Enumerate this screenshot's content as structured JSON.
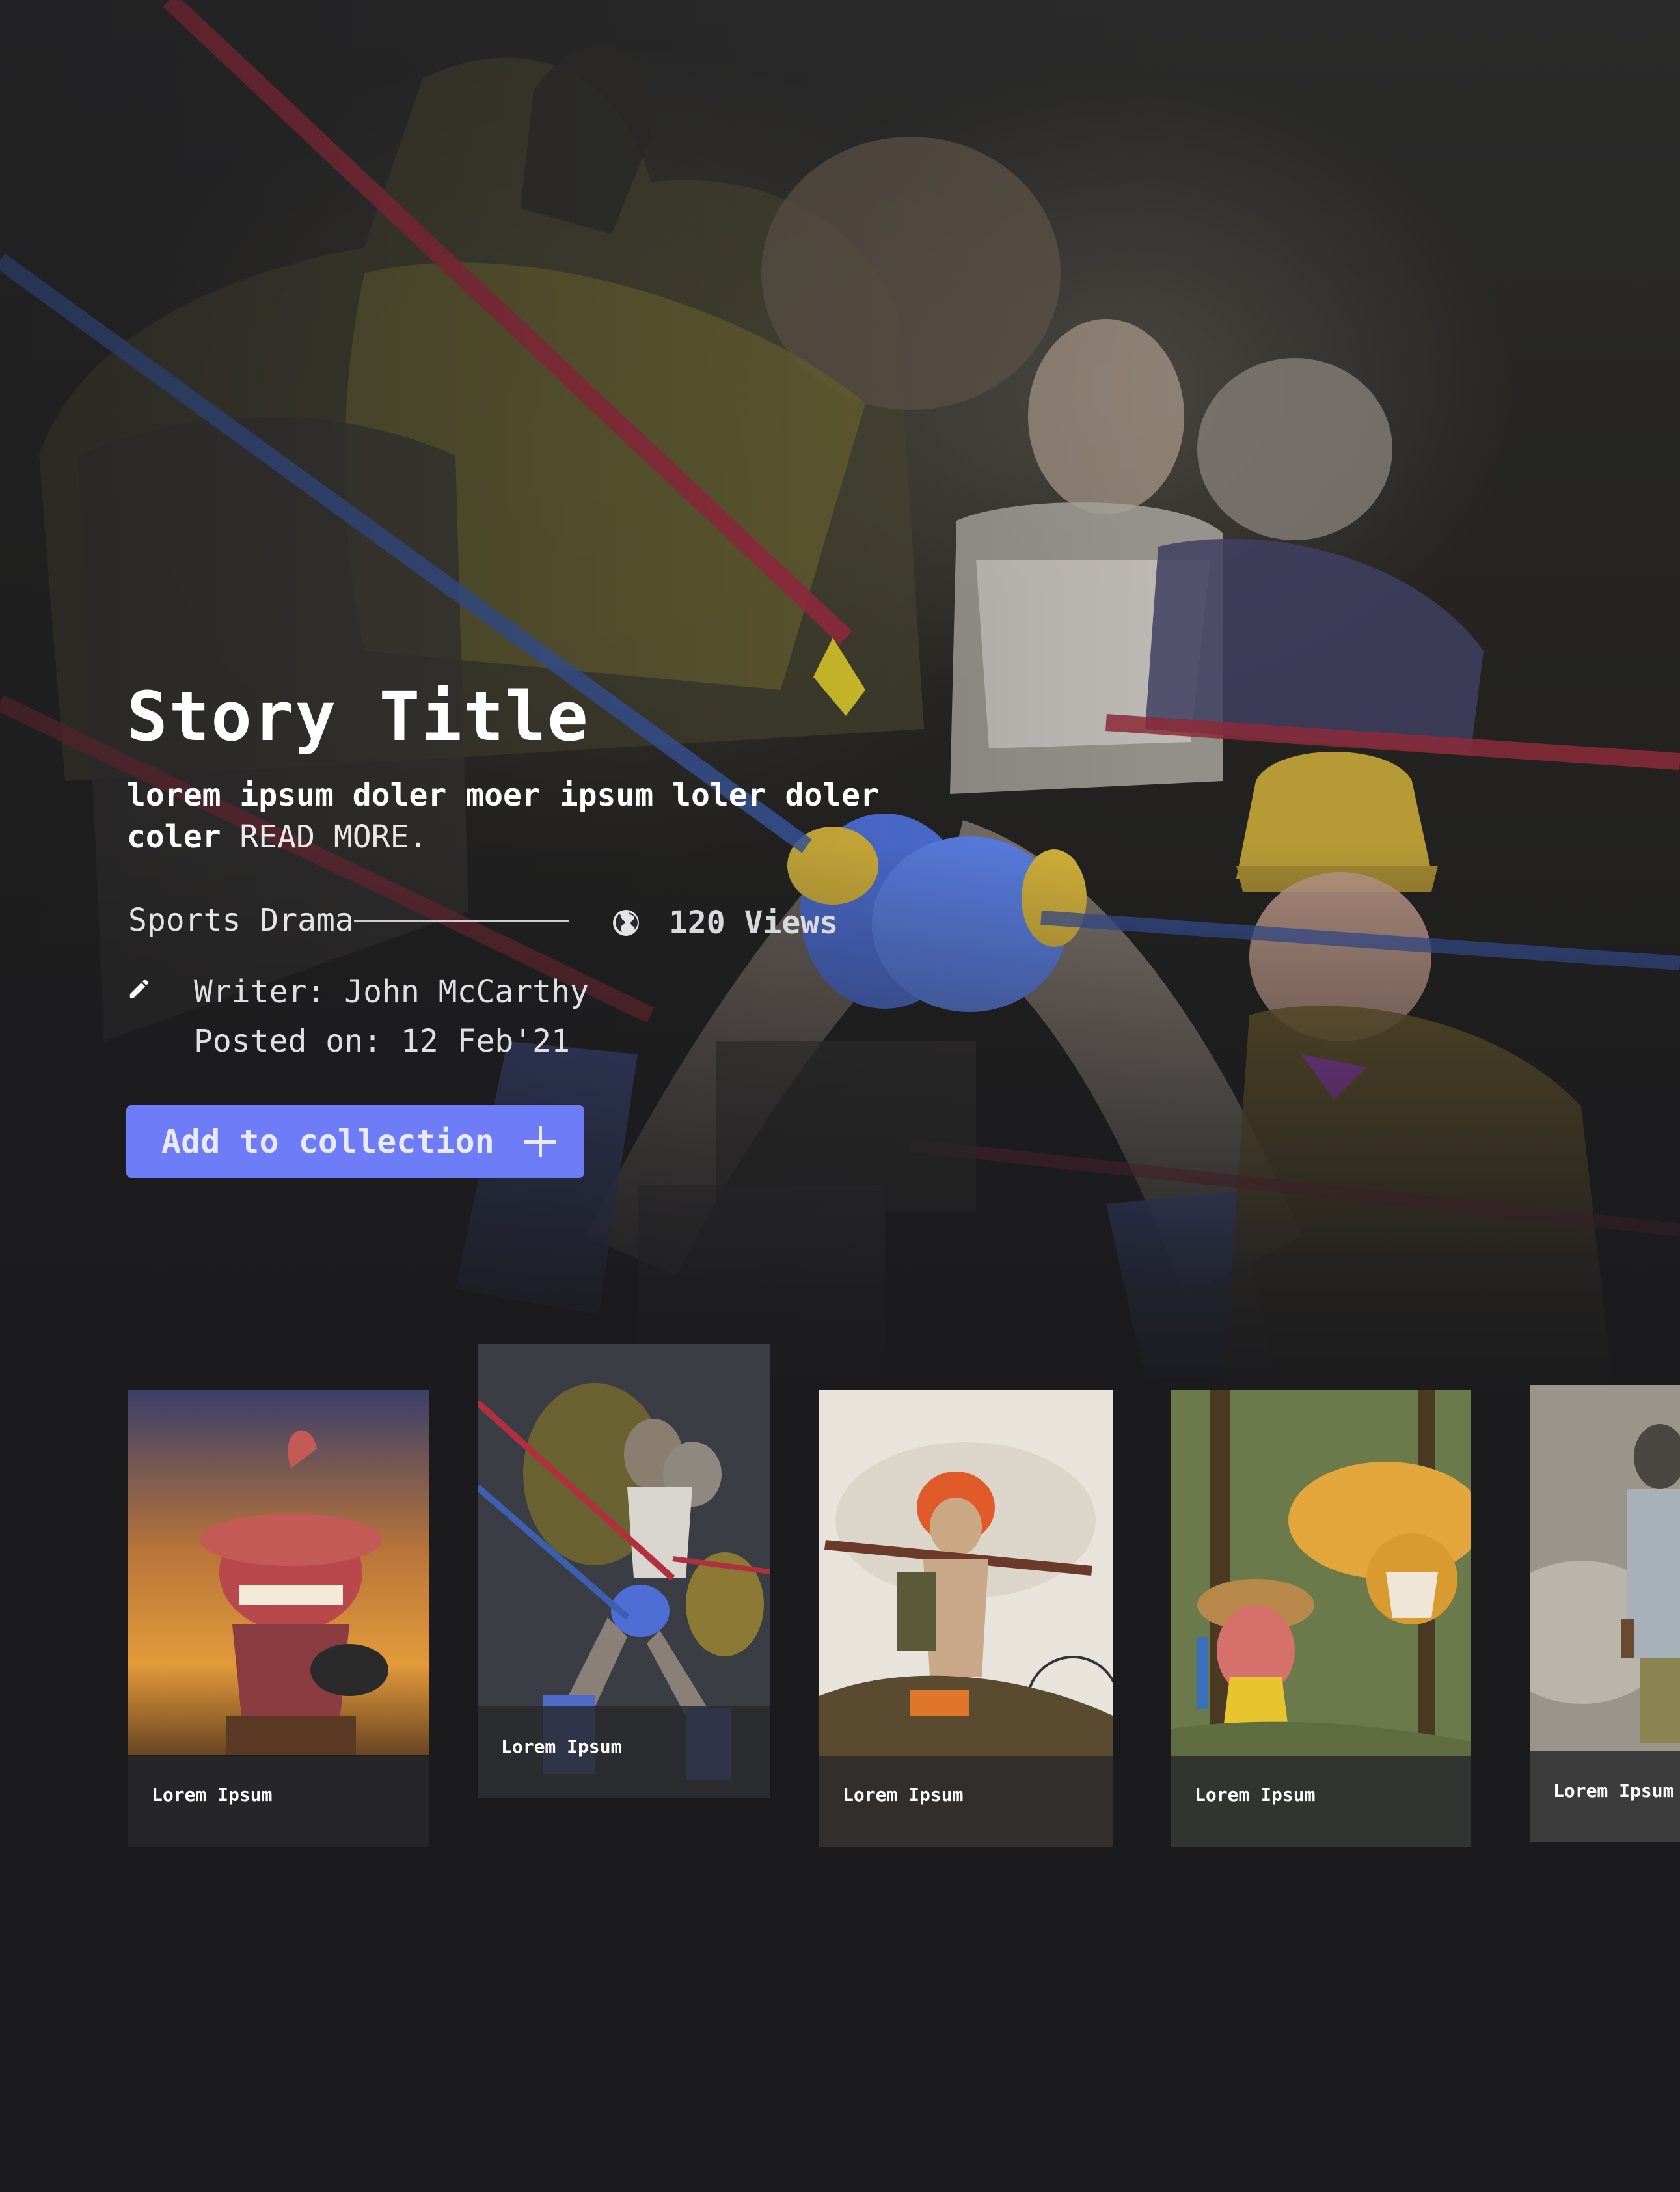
{
  "hero": {
    "title": "Story Title",
    "description": "lorem ipsum doler moer ipsum loler doler coler",
    "read_more": "READ MORE.",
    "genre": "Sports Drama",
    "views": "120 Views",
    "writer": "Writer: John McCarthy",
    "posted": "Posted on: 12 Feb'21",
    "add_button": "Add to collection"
  },
  "cards": [
    {
      "caption": "Lorem Ipsum",
      "theme": "sunset-creature",
      "accent": "#e0912f"
    },
    {
      "caption": "Lorem Ipsum",
      "theme": "boxing-ring",
      "accent": "#4a5aa8"
    },
    {
      "caption": "Lorem Ipsum",
      "theme": "helmet-kid",
      "accent": "#e0562a"
    },
    {
      "caption": "Lorem Ipsum",
      "theme": "jungle-leopard",
      "accent": "#d9a030"
    },
    {
      "caption": "Lorem Ipsum",
      "theme": "desert-soldier",
      "accent": "#8c8a80"
    }
  ],
  "colors": {
    "background": "#1b1b1e",
    "button": "#6f7cf7",
    "button_text": "#e8eaff",
    "caption_bg": "#28282c"
  },
  "icons": {
    "views": "globe-icon",
    "writer": "pencil-icon",
    "add": "plus-icon"
  }
}
